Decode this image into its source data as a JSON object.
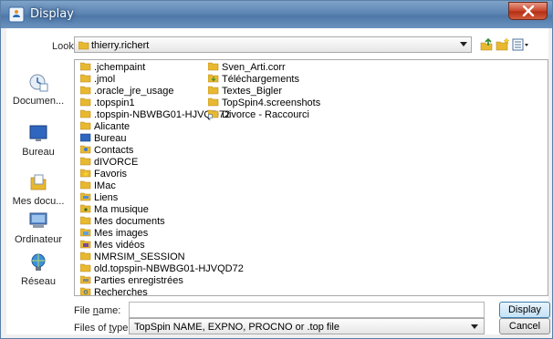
{
  "window": {
    "title": "Display",
    "close_icon": "close-icon"
  },
  "lookin": {
    "label": "Look in:",
    "value": "thierry.richert",
    "toolbar_icons": [
      "up-folder-icon",
      "new-folder-icon",
      "view-menu-icon"
    ]
  },
  "places": [
    {
      "label": "Documen...",
      "icon": "recent-documents-icon"
    },
    {
      "label": "Bureau",
      "icon": "desktop-icon"
    },
    {
      "label": "Mes docu...",
      "icon": "my-documents-icon"
    },
    {
      "label": "Ordinateur",
      "icon": "computer-icon"
    },
    {
      "label": "Réseau",
      "icon": "network-icon"
    }
  ],
  "files_col1": [
    ".jchempaint",
    ".jmol",
    ".oracle_jre_usage",
    ".topspin1",
    ".topspin-NBWBG01-HJVQD72",
    "Alicante",
    "Bureau",
    "Contacts",
    "dIVORCE",
    "Favoris",
    "IMac",
    "Liens",
    "Ma musique",
    "Mes documents",
    "Mes images",
    "Mes vidéos",
    "NMRSIM_SESSION",
    "old.topspin-NBWBG01-HJVQD72",
    "Parties enregistrées",
    "Recherches"
  ],
  "files_col2": [
    "Sven_Arti.corr",
    "Téléchargements",
    "Textes_Bigler",
    "TopSpin4.screenshots",
    "Divorce - Raccourci"
  ],
  "filename": {
    "label_pre": "File ",
    "label_mnemonic": "n",
    "label_post": "ame:",
    "value": ""
  },
  "filetype": {
    "label_pre": "Files of ",
    "label_mnemonic": "t",
    "label_post": "ype:",
    "value": "TopSpin NAME, EXPNO, PROCNO or .top file"
  },
  "buttons": {
    "display": "Display",
    "cancel": "Cancel"
  },
  "colors": {
    "folder": "#e8b930",
    "accent": "#3c7fb1"
  }
}
